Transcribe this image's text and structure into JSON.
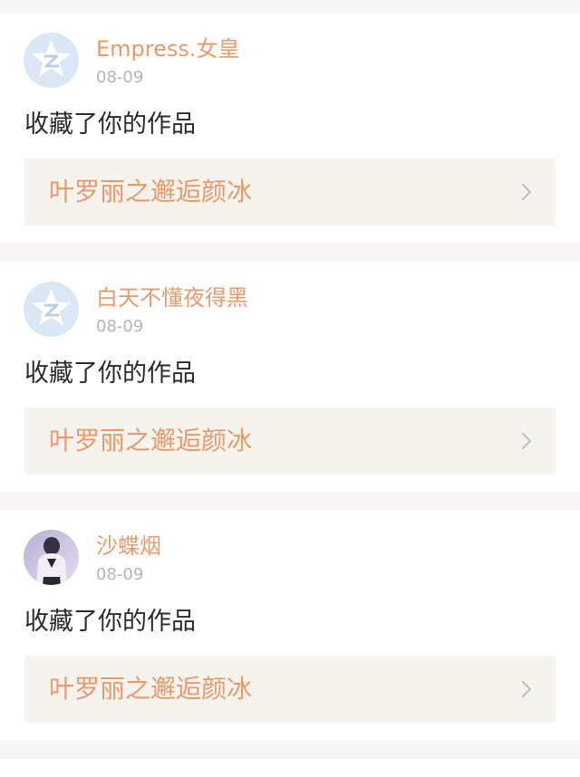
{
  "notifications": [
    {
      "username": "Empress.女皇",
      "date": "08-09",
      "action": "收藏了你的作品",
      "work_title": "叶罗丽之邂逅颜冰",
      "avatar": "default-qq-avatar-icon"
    },
    {
      "username": "白天不懂夜得黑",
      "date": "08-09",
      "action": "收藏了你的作品",
      "work_title": "叶罗丽之邂逅颜冰",
      "avatar": "default-qq-avatar-icon"
    },
    {
      "username": "沙蝶烟",
      "date": "08-09",
      "action": "收藏了你的作品",
      "work_title": "叶罗丽之邂逅颜冰",
      "avatar": "user-photo-avatar"
    }
  ],
  "colors": {
    "page_background": "#f7f5f6",
    "card_background": "#ffffff",
    "accent_orange": "#e99a6c",
    "date_gray": "#b5b5b5",
    "text_dark": "#2b2b2b",
    "work_box_background": "#f4f3ee",
    "chevron_gray": "#bdbdbd"
  }
}
